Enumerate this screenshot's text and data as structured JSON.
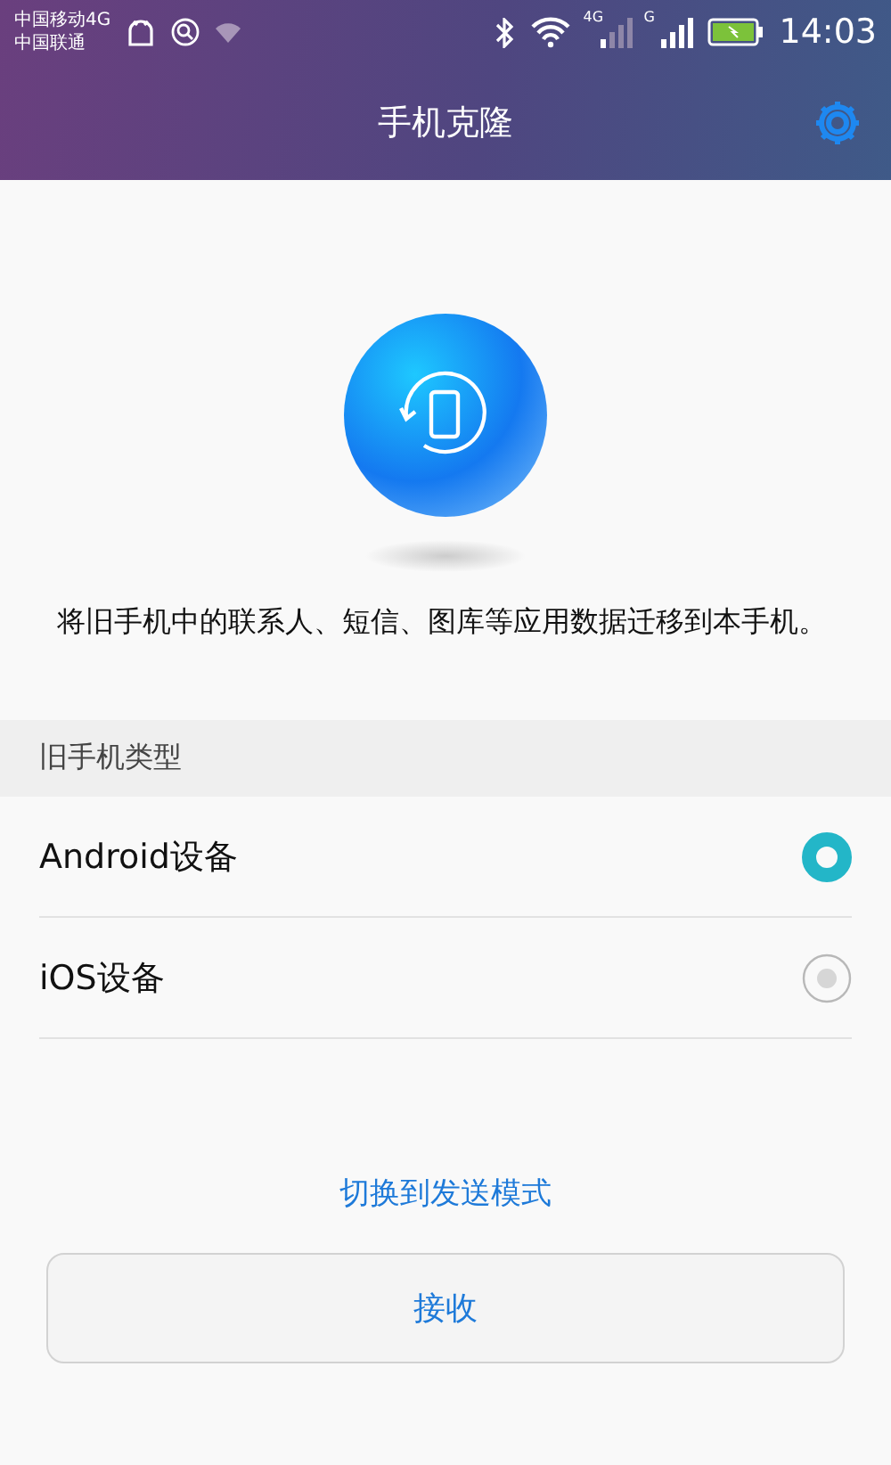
{
  "status_bar": {
    "carriers": [
      "中国移动4G",
      "中国联通"
    ],
    "network_labels": [
      "4G",
      "G"
    ],
    "time": "14:03"
  },
  "title_bar": {
    "title": "手机克隆"
  },
  "description": "将旧手机中的联系人、短信、图库等应用数据迁移到本手机。",
  "section": {
    "title": "旧手机类型",
    "options": [
      {
        "label": "Android设备",
        "selected": true
      },
      {
        "label": "iOS设备",
        "selected": false
      }
    ]
  },
  "switch_link": "切换到发送模式",
  "receive_button": "接收"
}
